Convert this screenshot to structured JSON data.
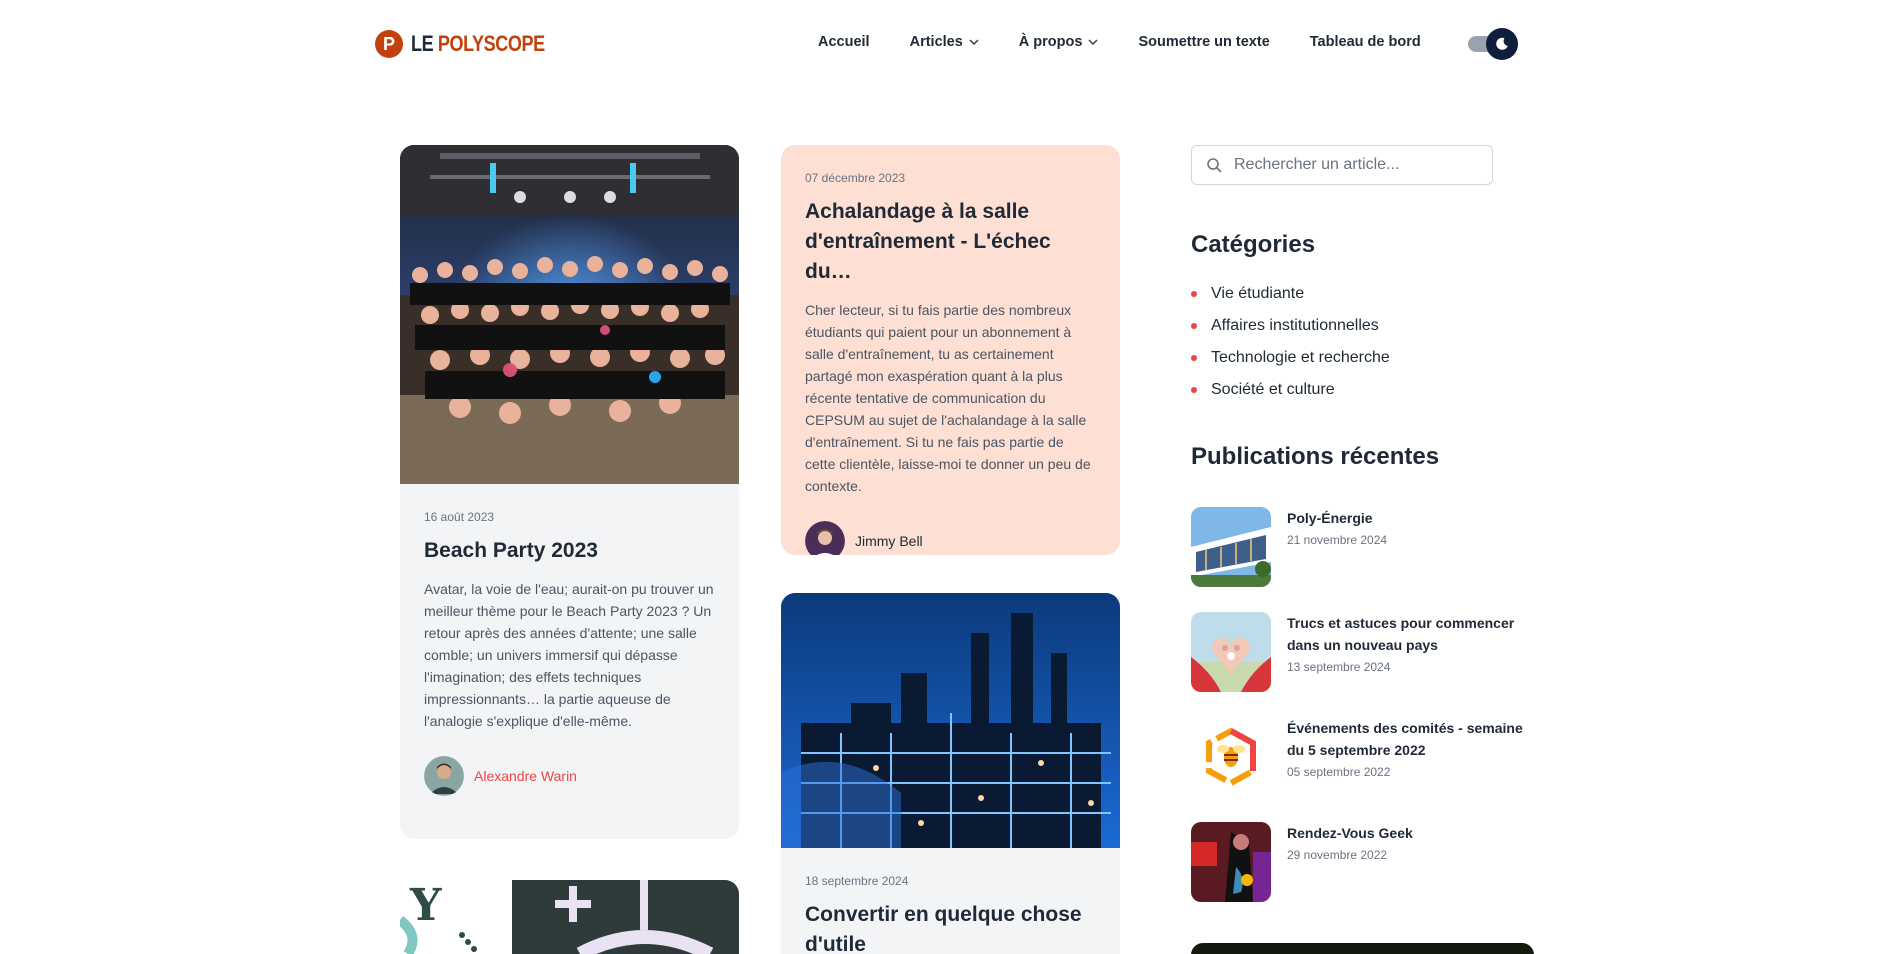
{
  "header": {
    "logo_mark": "P",
    "logo_word1": "LE",
    "logo_word2": "POLYSCOPE",
    "nav": [
      {
        "label": "Accueil"
      },
      {
        "label": "Articles"
      },
      {
        "label": "À propos"
      },
      {
        "label": "Soumettre un texte"
      },
      {
        "label": "Tableau de bord"
      }
    ],
    "theme_toggle_icon": "moon-icon"
  },
  "cards": {
    "beach": {
      "date": "16 août 2023",
      "title": "Beach Party 2023",
      "excerpt": "Avatar, la voie de l'eau; aurait-on pu trouver un meilleur thème pour le Beach Party 2023 ? Un retour après des années d'attente; une salle comble; un univers immersif qui dépasse l'imagination; des effets techniques impressionnants… la partie aqueuse de l'analogie s'explique d'elle-même.",
      "author": "Alexandre Warin",
      "author_color": "#ef4444"
    },
    "gym": {
      "date": "07 décembre 2023",
      "title": "Achalandage à la salle d'entraînement - L'échec du…",
      "excerpt": "Cher lecteur, si tu fais partie des nombreux étudiants qui paient pour un abonnement à salle d'entraînement, tu as certainement partagé mon exaspération quant à la plus récente tentative de communication du CEPSUM au sujet de l'achalandage à la salle d'entraînement. Si tu ne fais pas partie de cette clientèle, laisse-moi te donner un peu de contexte.",
      "author": "Jimmy Bell",
      "background": "#fde0d3"
    },
    "convert": {
      "date": "18 septembre 2024",
      "title": "Convertir en quelque chose d'utile"
    }
  },
  "sidebar": {
    "search_placeholder": "Rechercher un article...",
    "categories_title": "Catégories",
    "categories": [
      {
        "label": "Vie étudiante"
      },
      {
        "label": "Affaires institutionnelles"
      },
      {
        "label": "Technologie et recherche"
      },
      {
        "label": "Société et culture"
      }
    ],
    "recent_title": "Publications récentes",
    "recent": [
      {
        "title": "Poly-Énergie",
        "date": "21 novembre 2024"
      },
      {
        "title": "Trucs et astuces pour commencer dans un nouveau pays",
        "date": "13 septembre 2024"
      },
      {
        "title": "Événements des comités - semaine du 5 septembre 2022",
        "date": "05 septembre 2022"
      },
      {
        "title": "Rendez-Vous Geek",
        "date": "29 novembre 2022"
      }
    ]
  },
  "colors": {
    "accent": "#ef4444",
    "brand": "#c2410c",
    "card_gray": "#f3f4f6",
    "card_peach": "#fde0d3"
  }
}
